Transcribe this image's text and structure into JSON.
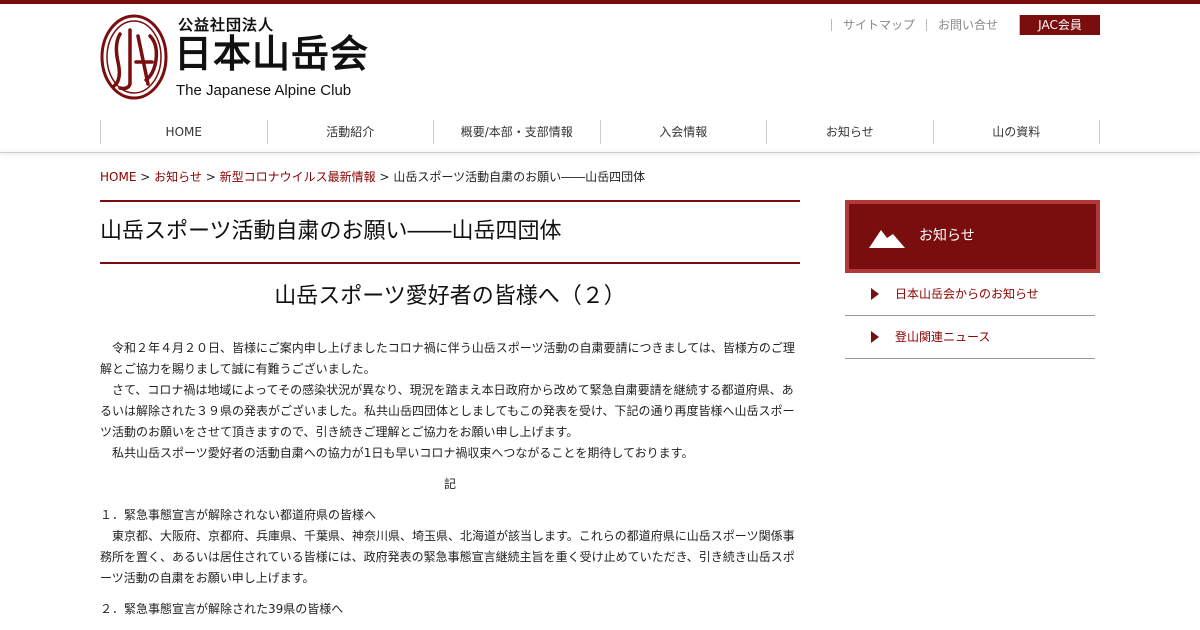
{
  "header": {
    "org_type": "公益社団法人",
    "org_name": "日本山岳会",
    "org_name_en": "The Japanese Alpine Club",
    "util_links": [
      "サイトマップ",
      "お問い合せ"
    ],
    "member_button": "JAC会員"
  },
  "nav": [
    "HOME",
    "活動紹介",
    "概要/本部・支部情報",
    "入会情報",
    "お知らせ",
    "山の資料"
  ],
  "breadcrumb": {
    "home": "HOME",
    "sep": ">",
    "items": [
      "お知らせ",
      "新型コロナウイルス最新情報"
    ],
    "current": "山岳スポーツ活動自粛のお願い――山岳四団体"
  },
  "article": {
    "title": "山岳スポーツ活動自粛のお願い――山岳四団体",
    "subtitle": "山岳スポーツ愛好者の皆様へ（２）",
    "paragraphs": [
      "　令和２年４月２０日、皆様にご案内申し上げましたコロナ禍に伴う山岳スポーツ活動の自粛要請につきましては、皆様方のご理解とご協力を賜りまして誠に有難うございました。",
      "　さて、コロナ禍は地域によってその感染状況が異なり、現況を踏まえ本日政府から改めて緊急自粛要請を継続する都道府県、あるいは解除された３９県の発表がございました。私共山岳四団体としましてもこの発表を受け、下記の通り再度皆様へ山岳スポーツ活動のお願いをさせて頂きますので、引き続きご理解とご協力をお願い申し上げます。",
      "　私共山岳スポーツ愛好者の活動自粛への協力が1日も早いコロナ禍収束へつながることを期待しております。"
    ],
    "ki": "記",
    "item1_title": "１．緊急事態宣言が解除されない都道府県の皆様へ",
    "item1_body": "　東京都、大阪府、京都府、兵庫県、千葉県、神奈川県、埼玉県、北海道が該当します。これらの都道府県に山岳スポーツ関係事務所を置く、あるいは居住されている皆様には、政府発表の緊急事態宣言継続主旨を重く受け止めていただき、引き続き山岳スポーツ活動の自粛をお願い申し上げます。",
    "item2_title": "２．緊急事態宣言が解除された39県の皆様へ"
  },
  "sidebar": {
    "heading": "お知らせ",
    "items": [
      "日本山岳会からのお知らせ",
      "登山関連ニュース"
    ]
  },
  "colors": {
    "brand": "#7a0d0d",
    "link": "#8b0000"
  }
}
